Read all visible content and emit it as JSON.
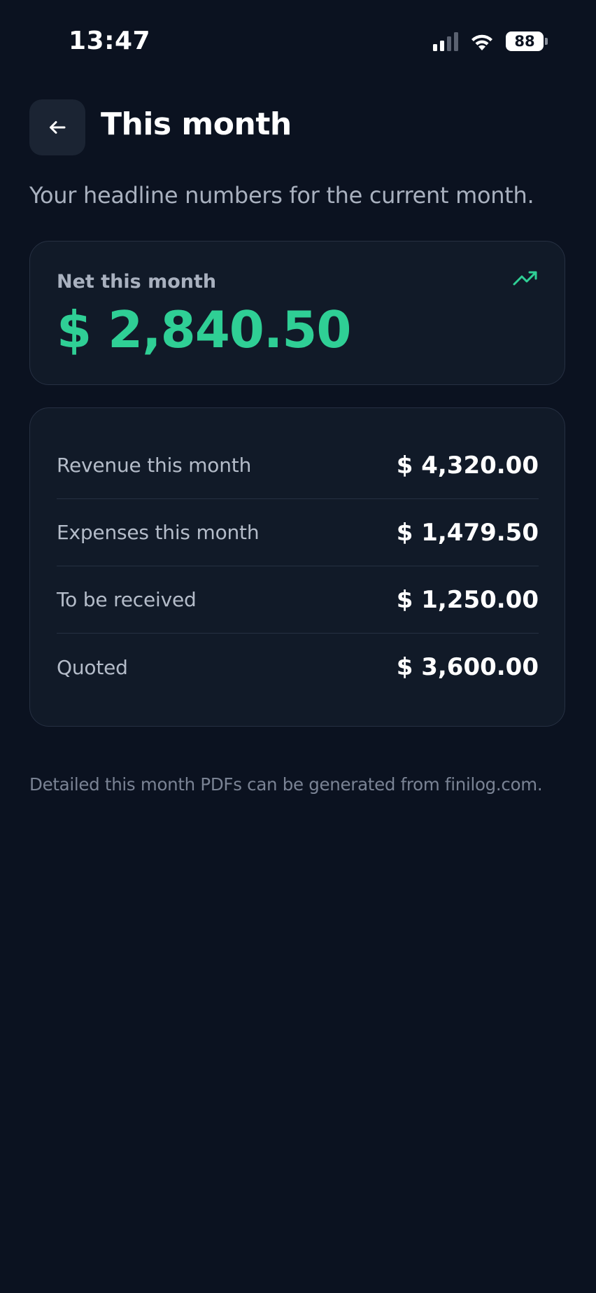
{
  "status_bar": {
    "time": "13:47",
    "battery_level": "88",
    "signal_icon": "cellular-signal-icon",
    "wifi_icon": "wifi-icon"
  },
  "header": {
    "back_icon": "arrow-left-icon",
    "title": "This month",
    "subtitle": "Your headline numbers for the current month."
  },
  "net_card": {
    "label": "Net this month",
    "value": "$ 2,840.50",
    "trend_icon": "trending-up-icon",
    "accent_color": "#2fcf95"
  },
  "breakdown": {
    "rows": [
      {
        "label": "Revenue this month",
        "value": "$ 4,320.00"
      },
      {
        "label": "Expenses this month",
        "value": "$ 1,479.50"
      },
      {
        "label": "To be received",
        "value": "$ 1,250.00"
      },
      {
        "label": "Quoted",
        "value": "$ 3,600.00"
      }
    ]
  },
  "footnote": "Detailed this month PDFs can be generated from finilog.com.",
  "colors": {
    "background": "#0b1220",
    "card": "#111a28",
    "card_border": "#263042",
    "accent": "#2fcf95"
  }
}
